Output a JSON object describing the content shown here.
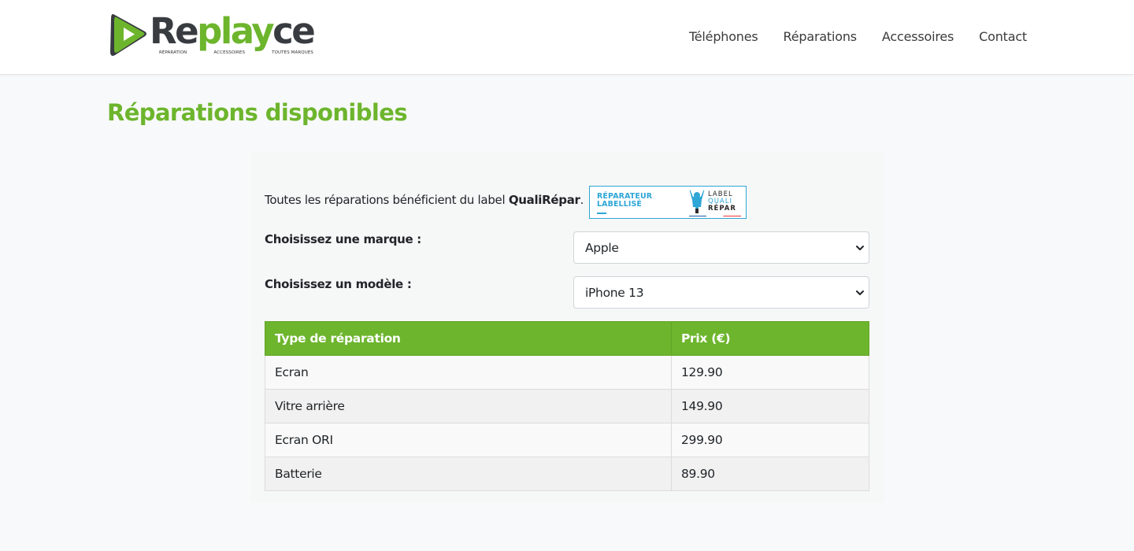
{
  "brand": {
    "name_part1": "Re",
    "name_part2": "play",
    "name_part3": "ce",
    "tagline": [
      "RÉPARATION",
      "ACCESSOIRES",
      "TOUTES MARQUES"
    ],
    "color_dark": "#383c40",
    "color_green": "#6db52d"
  },
  "nav": {
    "items": [
      {
        "label": "Téléphones"
      },
      {
        "label": "Réparations"
      },
      {
        "label": "Accessoires"
      },
      {
        "label": "Contact"
      }
    ]
  },
  "page": {
    "title": "Réparations disponibles"
  },
  "intro": {
    "text_before": "Toutes les réparations bénéficient du label ",
    "label_name": "QualiRépar",
    "text_after": "."
  },
  "badge": {
    "left_line1": "RÉPARATEUR",
    "left_line2": "LABELLISÉ",
    "right_line1": "LABEL",
    "right_line2": "QUALI",
    "right_line3": "RÉPAR",
    "accent": "#2ea6d6"
  },
  "form": {
    "brand_label": "Choisissez une marque :",
    "brand_value": "Apple",
    "model_label": "Choisissez un modèle :",
    "model_value": "iPhone 13"
  },
  "table": {
    "headers": [
      "Type de réparation",
      "Prix (€)"
    ],
    "rows": [
      {
        "type": "Ecran",
        "price": "129.90"
      },
      {
        "type": "Vitre arrière",
        "price": "149.90"
      },
      {
        "type": "Ecran ORI",
        "price": "299.90"
      },
      {
        "type": "Batterie",
        "price": "89.90"
      }
    ]
  }
}
